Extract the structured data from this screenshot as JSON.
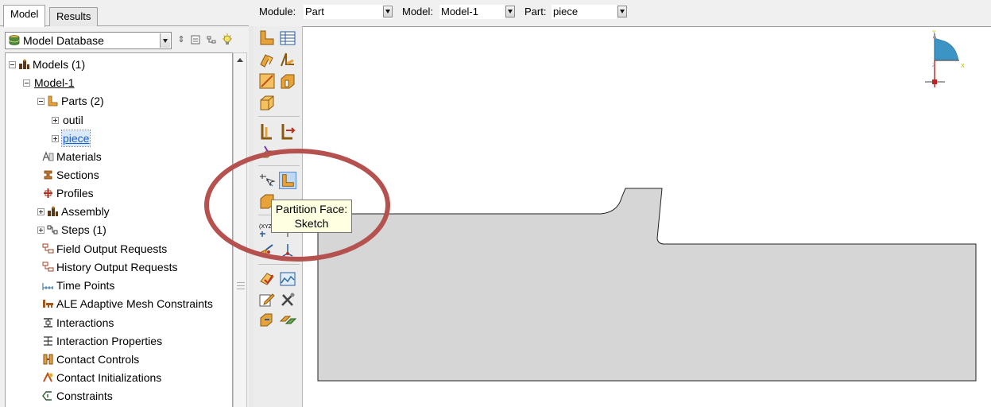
{
  "tabs": [
    {
      "label": "Model",
      "active": true
    },
    {
      "label": "Results",
      "active": false
    }
  ],
  "database": {
    "selected": "Model Database",
    "icon": "database-icon"
  },
  "tree": {
    "models": "Models (1)",
    "model1": "Model-1",
    "parts": "Parts (2)",
    "part_outil": "outil",
    "part_piece": "piece",
    "materials": "Materials",
    "sections": "Sections",
    "profiles": "Profiles",
    "assembly": "Assembly",
    "steps": "Steps (1)",
    "field_output": "Field Output Requests",
    "history_output": "History Output Requests",
    "time_points": "Time Points",
    "ale": "ALE Adaptive Mesh Constraints",
    "interactions": "Interactions",
    "interaction_props": "Interaction Properties",
    "contact_controls": "Contact Controls",
    "contact_init": "Contact Initializations",
    "constraints": "Constraints"
  },
  "context": {
    "module_label": "Module:",
    "module_value": "Part",
    "model_label": "Model:",
    "model_value": "Model-1",
    "part_label": "Part:",
    "part_value": "piece"
  },
  "tooltip": {
    "line1": "Partition Face:",
    "line2": "Sketch"
  },
  "triad": {
    "x": "X",
    "y": "Y",
    "z": "Z"
  },
  "colors": {
    "part_fill": "#d6d6d6",
    "highlight_circle": "#b5524f",
    "tooltip_bg": "#ffffe1",
    "selection": "#1a5fc7"
  }
}
